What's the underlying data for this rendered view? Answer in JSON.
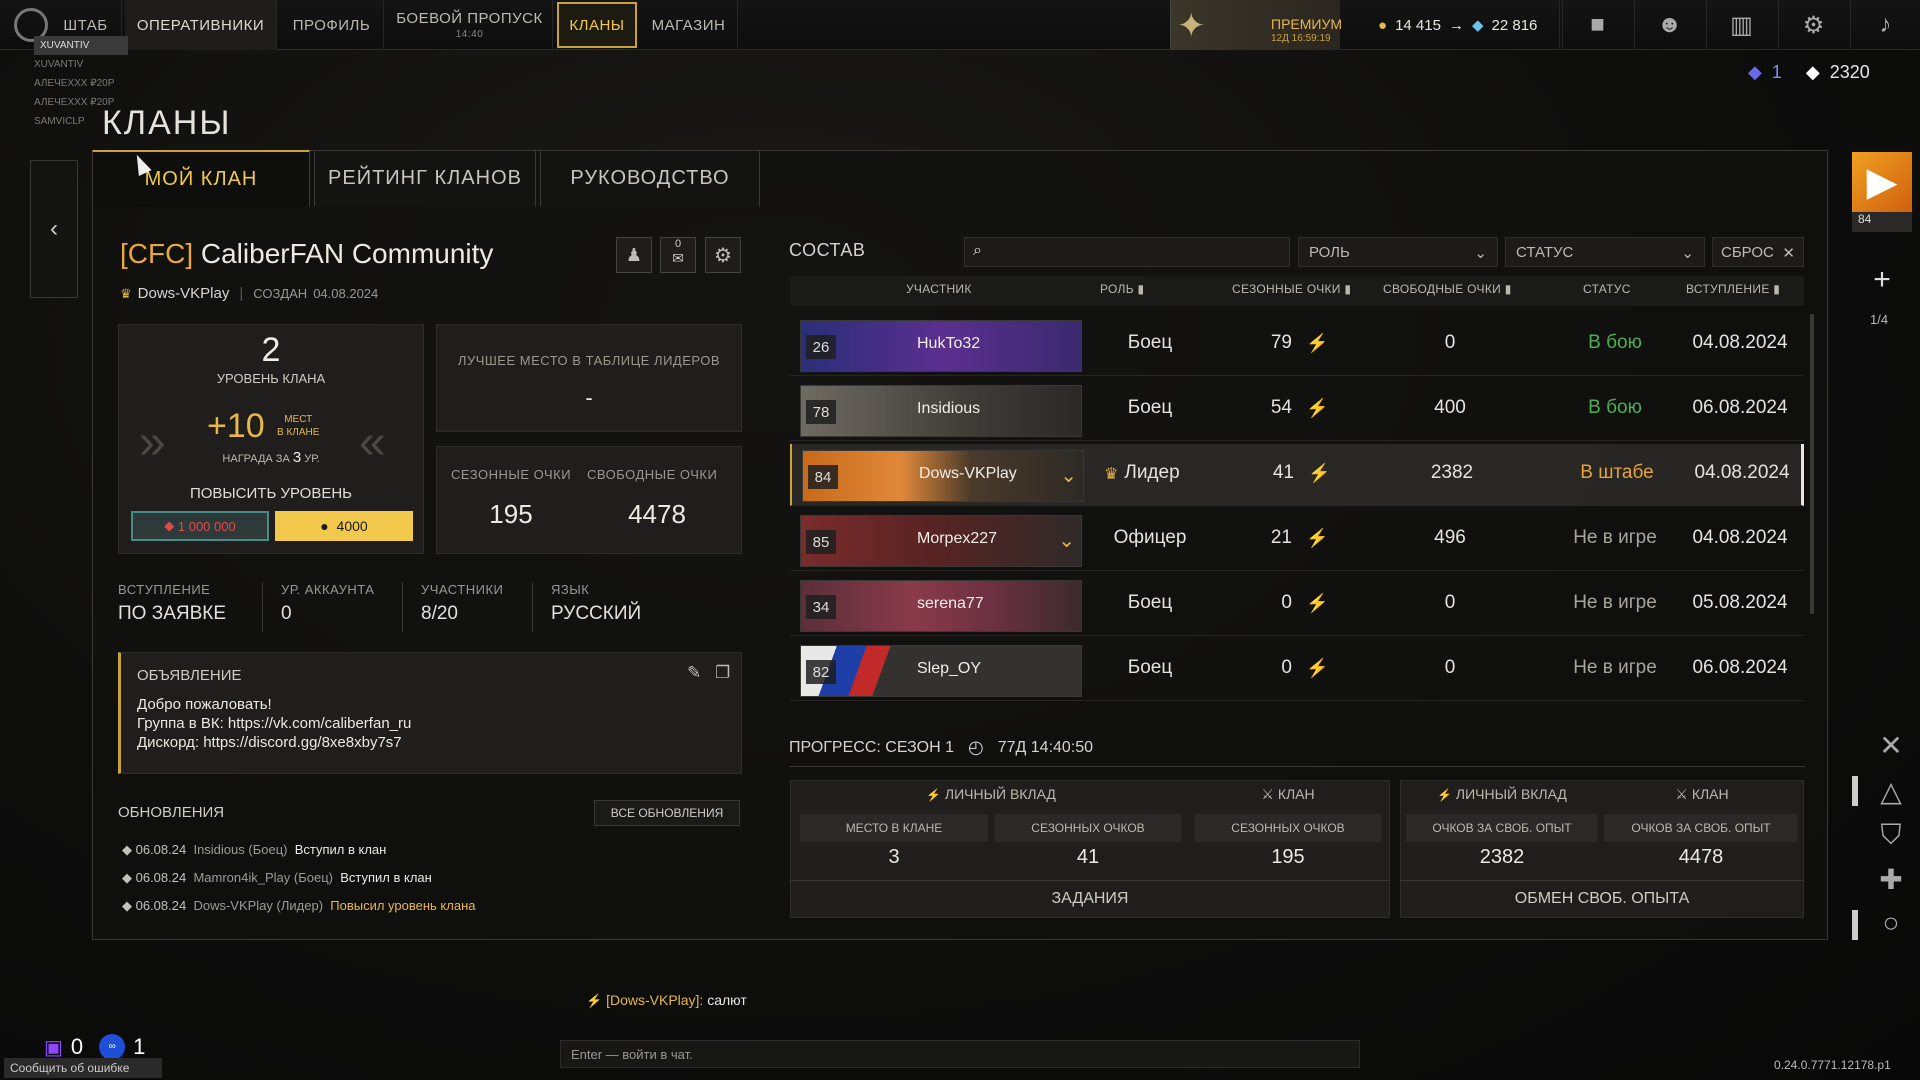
{
  "topbar": {
    "nav": [
      {
        "label": "ШТАБ",
        "sub": ""
      },
      {
        "label": "ОПЕРАТИВНИКИ",
        "sub": ""
      },
      {
        "label": "ПРОФИЛЬ",
        "sub": ""
      },
      {
        "label": "БОЕВОЙ ПРОПУСК",
        "sub": "14:40"
      },
      {
        "label": "КЛАНЫ",
        "sub": ""
      },
      {
        "label": "МАГАЗИН",
        "sub": ""
      }
    ],
    "premium": {
      "label": "ПРЕМИУМ",
      "time": "12Д 16:59:19"
    },
    "currency_silver": "14 415",
    "currency_arrow": "→",
    "currency_credits": "22 816",
    "tickets": "1",
    "points": "2320"
  },
  "friends_overlay": [
    "XUVANTIV",
    "XUVANTIV",
    "АЛЕЧЕХХХ ₽20P",
    "АЛЕЧЕХХХ ₽20P",
    "SAMVICLP"
  ],
  "page_title": "КЛАНЫ",
  "tabs": [
    "МОЙ КЛАН",
    "РЕЙТИНГ КЛАНОВ",
    "РУКОВОДСТВО"
  ],
  "clan": {
    "tag": "[CFC]",
    "name": "CaliberFAN Community",
    "leader": "Dows-VKPlay",
    "created_label": "СОЗДАН",
    "created_date": "04.08.2024",
    "mail_count": "0",
    "level": "2",
    "level_label": "УРОВЕНЬ КЛАНА",
    "bonus": "+10",
    "bonus_label1": "МЕСТ",
    "bonus_label2": "В КЛАНЕ",
    "reward_text": "НАГРАДА ЗА",
    "reward_level": "3",
    "reward_suffix": "УР.",
    "upgrade_label": "ПОВЫСИТЬ УРОВЕНЬ",
    "upgrade_cost_red": "1 000 000",
    "upgrade_cost_gold": "4000",
    "best_place_label": "ЛУЧШЕЕ МЕСТО В ТАБЛИЦЕ ЛИДЕРОВ",
    "best_place_value": "-",
    "season_points_label": "СЕЗОННЫЕ ОЧКИ",
    "season_points": "195",
    "free_points_label": "СВОБОДНЫЕ ОЧКИ",
    "free_points": "4478",
    "info": [
      {
        "label": "ВСТУПЛЕНИЕ",
        "value": "ПО ЗАЯВКЕ"
      },
      {
        "label": "УР. АККАУНТА",
        "value": "0"
      },
      {
        "label": "УЧАСТНИКИ",
        "value": "8/20"
      },
      {
        "label": "ЯЗЫК",
        "value": "РУССКИЙ"
      }
    ],
    "announcement_title": "ОБЪЯВЛЕНИЕ",
    "announcement_lines": [
      "Добро пожаловать!",
      "Группа в ВК: https://vk.com/caliberfan_ru",
      "Дискорд: https://discord.gg/8xe8xby7s7"
    ],
    "updates_title": "ОБНОВЛЕНИЯ",
    "updates_all": "ВСЕ ОБНОВЛЕНИЯ",
    "updates": [
      {
        "date": "06.08.24",
        "who": "Insidious (Боец)",
        "action": "Вступил в клан",
        "gold": false
      },
      {
        "date": "06.08.24",
        "who": "Mamron4ik_Play (Боец)",
        "action": "Вступил в клан",
        "gold": false
      },
      {
        "date": "06.08.24",
        "who": "Dows-VKPlay (Лидер)",
        "action": "Повысил уровень клана",
        "gold": true
      }
    ]
  },
  "roster": {
    "title": "СОСТАВ",
    "search_placeholder": "",
    "role_filter": "РОЛЬ",
    "status_filter": "СТАТУС",
    "reset": "СБРОС",
    "headers": [
      "УЧАСТНИК",
      "РОЛЬ",
      "СЕЗОННЫЕ ОЧКИ",
      "СВОБОДНЫЕ ОЧКИ",
      "СТАТУС",
      "ВСТУПЛЕНИЕ"
    ],
    "members": [
      {
        "level": "26",
        "name": "HukTo32",
        "role": "Боец",
        "season": "79",
        "free": "0",
        "status": "В бою",
        "status_color": "#4caf50",
        "joined": "04.08.2024",
        "bg": "linear-gradient(90deg,#2b2e78,#5a2f8f 50%,#3a2a6e)",
        "chevron": false,
        "crown": false
      },
      {
        "level": "78",
        "name": "Insidious",
        "role": "Боец",
        "season": "54",
        "free": "400",
        "status": "В бою",
        "status_color": "#4caf50",
        "joined": "06.08.2024",
        "bg": "linear-gradient(90deg,#6f6a62,#3f3c38 60%,#2a2927)",
        "chevron": false,
        "crown": false
      },
      {
        "level": "84",
        "name": "Dows-VKPlay",
        "role": "Лидер",
        "season": "41",
        "free": "2382",
        "status": "В штабе",
        "status_color": "#e8a23a",
        "joined": "04.08.2024",
        "bg": "linear-gradient(90deg,#c86a1a,#e0883a 35%,#4a3a2a 60%,#2d2a26)",
        "chevron": true,
        "crown": true
      },
      {
        "level": "85",
        "name": "Morpex227",
        "role": "Офицер",
        "season": "21",
        "free": "496",
        "status": "Не в игре",
        "status_color": "#a8a59d",
        "joined": "04.08.2024",
        "bg": "linear-gradient(90deg,#7a2c2c,#5a2323 45%,#2f2a28)",
        "chevron": true,
        "crown": false
      },
      {
        "level": "34",
        "name": "serena77",
        "role": "Боец",
        "season": "0",
        "free": "0",
        "status": "Не в игре",
        "status_color": "#a8a59d",
        "joined": "05.08.2024",
        "bg": "linear-gradient(90deg,#5a2f3a,#8a3a4a 40%,#6a3040 70%,#3a2a2e)",
        "chevron": false,
        "crown": false
      },
      {
        "level": "82",
        "name": "Slep_OY",
        "role": "Боец",
        "season": "0",
        "free": "0",
        "status": "Не в игре",
        "status_color": "#a8a59d",
        "joined": "06.08.2024",
        "bg": "linear-gradient(110deg,#e8e8e8 12%,#1f3fa8 12%,#1f3fa8 22%,#c22a2a 22%,#c22a2a 30%,#343230 30%)",
        "chevron": false,
        "crown": false
      }
    ],
    "page": "1/4"
  },
  "progress": {
    "title": "ПРОГРЕСС: СЕЗОН 1",
    "timer": "77Д 14:40:50",
    "personal": "ЛИЧНЫЙ ВКЛАД",
    "clan": "КЛАН",
    "cols": [
      {
        "label": "МЕСТО В КЛАНЕ",
        "value": "3"
      },
      {
        "label": "СЕЗОННЫХ ОЧКОВ",
        "value": "41"
      },
      {
        "label": "СЕЗОННЫХ ОЧКОВ",
        "value": "195"
      },
      {
        "label": "ОЧКОВ ЗА СВОБ. ОПЫТ",
        "value": "2382"
      },
      {
        "label": "ОЧКОВ ЗА СВОБ. ОПЫТ",
        "value": "4478"
      }
    ],
    "tasks": "ЗАДАНИЯ",
    "exchange": "ОБМЕН СВОБ. ОПЫТА"
  },
  "chat": {
    "sender": "[Dows-VKPlay]:",
    "message": "салют",
    "placeholder": "Enter — войти в чат."
  },
  "bottom": {
    "twitch_count": "0",
    "other_count": "1",
    "report": "Сообщить об ошибке",
    "version": "0.24.0.7771.12178.p1"
  },
  "side_badge": "84"
}
